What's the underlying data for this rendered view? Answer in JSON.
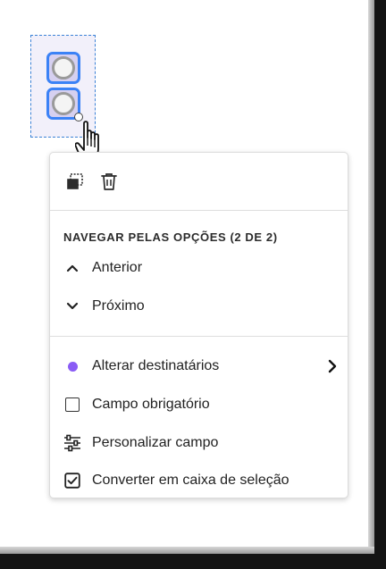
{
  "field": {
    "widgets": [
      "radio-option-1",
      "radio-option-2"
    ]
  },
  "menu": {
    "toolbar": {
      "duplicate_icon": "duplicate-icon",
      "delete_icon": "trash-icon"
    },
    "navigate_heading": "NAVEGAR PELAS OPÇÕES (2 DE 2)",
    "previous_label": "Anterior",
    "next_label": "Próximo",
    "recipients_label": "Alterar destinatários",
    "recipient_color": "#8a5cf5",
    "required_label": "Campo obrigatório",
    "customize_label": "Personalizar campo",
    "convert_label": "Converter em caixa de seleção"
  },
  "colors": {
    "accent": "#3b82f6",
    "field_fill": "#d6d0f0",
    "selection_border": "#3b82d6"
  }
}
